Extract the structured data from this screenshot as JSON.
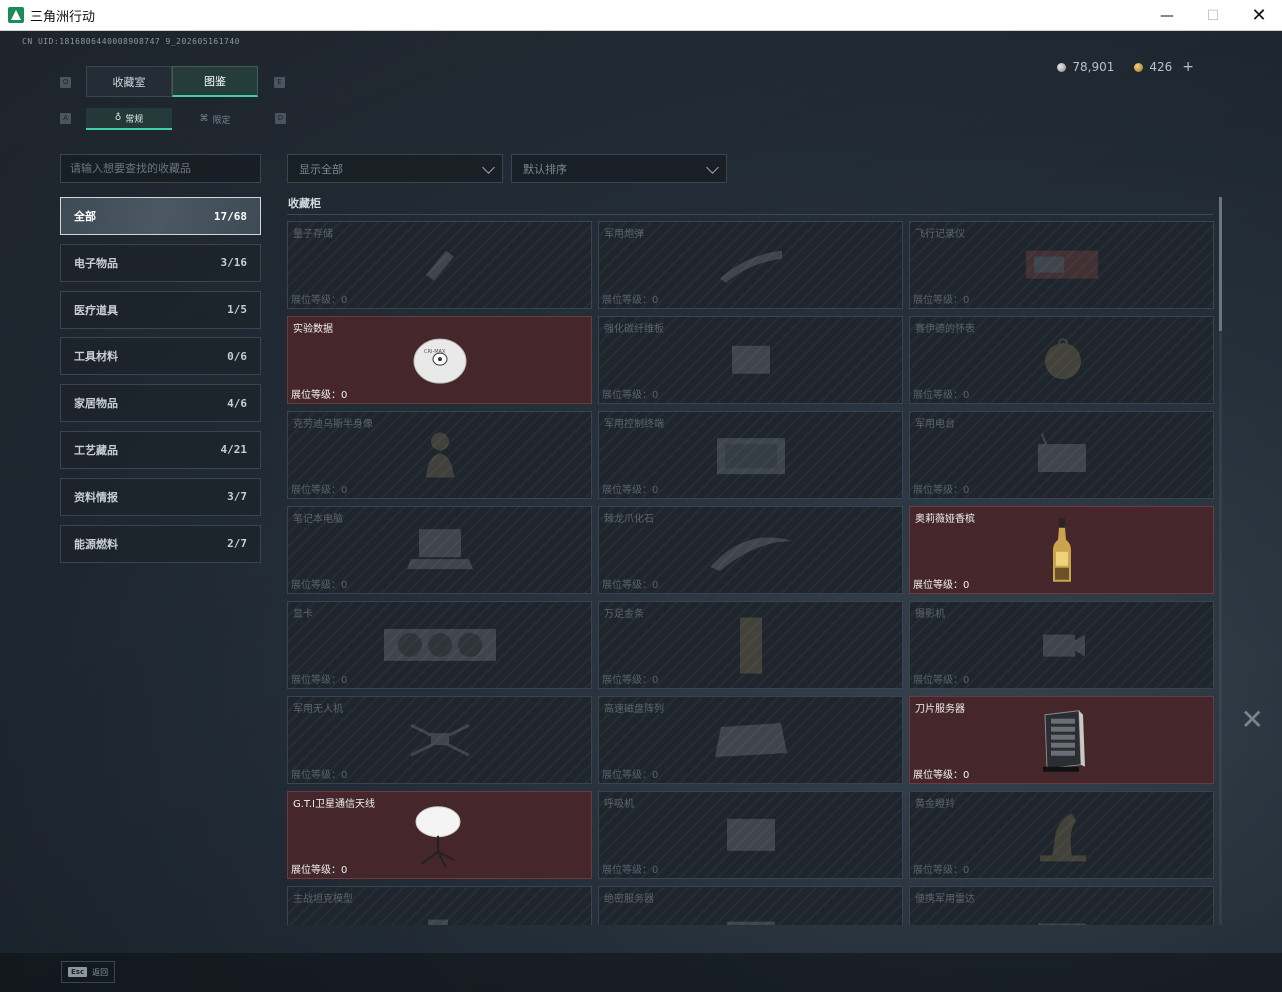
{
  "window": {
    "title": "三角洲行动"
  },
  "uid": "CN UID:1816806440008908747 9_202605161740",
  "currency": {
    "silver": "78,901",
    "gold": "426",
    "add": "+"
  },
  "keys": {
    "tab_left": "Q",
    "tab_right": "E",
    "sub_left": "A",
    "sub_right": "D"
  },
  "tabs": [
    {
      "label": "收藏室",
      "active": false
    },
    {
      "label": "图鉴",
      "active": true
    }
  ],
  "subtabs": [
    {
      "label": "常规",
      "active": true
    },
    {
      "label": "限定",
      "active": false
    }
  ],
  "search": {
    "placeholder": "请输入想要查找的收藏品"
  },
  "filters": {
    "show": "显示全部",
    "sort": "默认排序"
  },
  "categories": [
    {
      "label": "全部",
      "count": "17/68",
      "active": true
    },
    {
      "label": "电子物品",
      "count": "3/16"
    },
    {
      "label": "医疗道具",
      "count": "1/5"
    },
    {
      "label": "工具材料",
      "count": "0/6"
    },
    {
      "label": "家居物品",
      "count": "4/6"
    },
    {
      "label": "工艺藏品",
      "count": "4/21"
    },
    {
      "label": "资料情报",
      "count": "3/7"
    },
    {
      "label": "能源燃料",
      "count": "2/7"
    }
  ],
  "section": {
    "title": "收藏柜",
    "level_prefix": "展位等级："
  },
  "items": [
    {
      "name": "量子存储",
      "level": "0",
      "owned": false,
      "icon": "usb-drive-icon"
    },
    {
      "name": "军用炮弹",
      "level": "0",
      "owned": false,
      "icon": "artillery-shell-icon"
    },
    {
      "name": "飞行记录仪",
      "level": "0",
      "owned": false,
      "icon": "flight-recorder-icon"
    },
    {
      "name": "实验数据",
      "level": "0",
      "owned": true,
      "icon": "disc-icon"
    },
    {
      "name": "强化碳纤维板",
      "level": "0",
      "owned": false,
      "icon": "carbon-plate-icon"
    },
    {
      "name": "赛伊德的怀表",
      "level": "0",
      "owned": false,
      "icon": "pocket-watch-icon"
    },
    {
      "name": "克劳迪乌斯半身像",
      "level": "0",
      "owned": false,
      "icon": "bust-statue-icon"
    },
    {
      "name": "军用控制终端",
      "level": "0",
      "owned": false,
      "icon": "control-terminal-icon"
    },
    {
      "name": "军用电台",
      "level": "0",
      "owned": false,
      "icon": "radio-icon"
    },
    {
      "name": "笔记本电脑",
      "level": "0",
      "owned": false,
      "icon": "laptop-icon"
    },
    {
      "name": "棘龙爪化石",
      "level": "0",
      "owned": false,
      "icon": "fossil-claw-icon"
    },
    {
      "name": "奥莉薇娅香槟",
      "level": "0",
      "owned": true,
      "icon": "champagne-bottle-icon"
    },
    {
      "name": "显卡",
      "level": "0",
      "owned": false,
      "icon": "graphics-card-icon"
    },
    {
      "name": "万足金条",
      "level": "0",
      "owned": false,
      "icon": "gold-bar-icon"
    },
    {
      "name": "摄影机",
      "level": "0",
      "owned": false,
      "icon": "camera-icon"
    },
    {
      "name": "军用无人机",
      "level": "0",
      "owned": false,
      "icon": "drone-icon"
    },
    {
      "name": "高速磁盘阵列",
      "level": "0",
      "owned": false,
      "icon": "disk-array-icon"
    },
    {
      "name": "刀片服务器",
      "level": "0",
      "owned": true,
      "icon": "server-icon"
    },
    {
      "name": "G.T.I卫星通信天线",
      "level": "0",
      "owned": true,
      "icon": "satellite-dish-icon"
    },
    {
      "name": "呼吸机",
      "level": "0",
      "owned": false,
      "icon": "ventilator-icon"
    },
    {
      "name": "黄金瞪羚",
      "level": "0",
      "owned": false,
      "icon": "gazelle-statue-icon"
    },
    {
      "name": "主战坦克模型",
      "level": "",
      "owned": false,
      "icon": "tank-model-icon"
    },
    {
      "name": "绝密服务器",
      "level": "",
      "owned": false,
      "icon": "secret-server-icon"
    },
    {
      "name": "便携军用雷达",
      "level": "",
      "owned": false,
      "icon": "radar-icon"
    }
  ],
  "bottom": {
    "esc_key": "Esc",
    "back": "返回"
  }
}
